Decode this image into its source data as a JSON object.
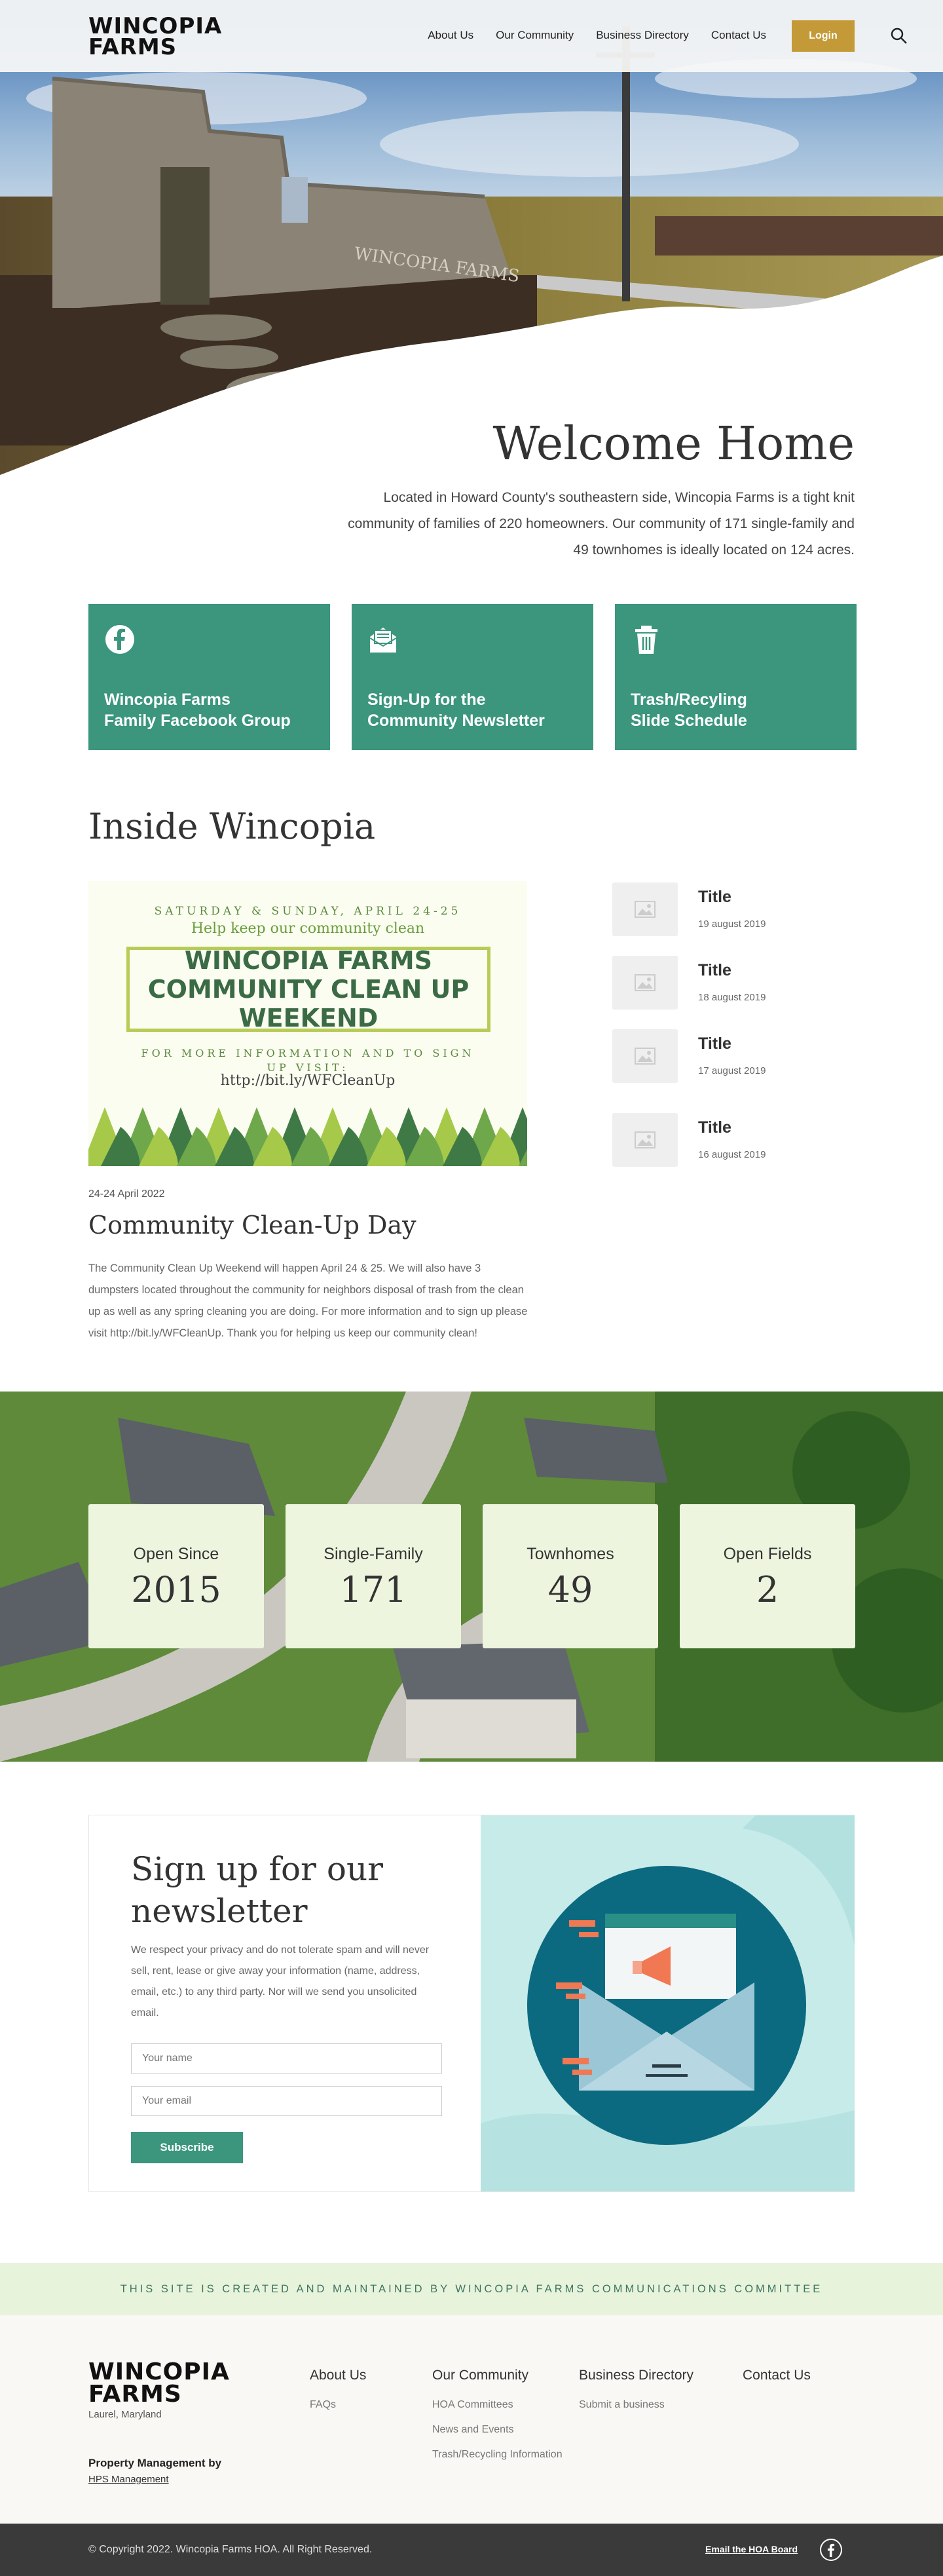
{
  "header": {
    "logo": "WINCOPIA\nFARMS",
    "nav": [
      "About Us",
      "Our Community",
      "Business Directory",
      "Contact Us"
    ],
    "login": "Login",
    "search_icon": "search-icon"
  },
  "welcome": {
    "title": "Welcome Home",
    "text": "Located in Howard County's southeastern side, Wincopia Farms is a tight knit community of families of 220 homeowners. Our community of 171 single-family and 49 townhomes is ideally located on 124 acres."
  },
  "cards": [
    {
      "label": "Wincopia Farms\nFamily Facebook Group",
      "icon": "facebook-icon"
    },
    {
      "label": "Sign-Up for the\nCommunity Newsletter",
      "icon": "envelope-icon"
    },
    {
      "label": "Trash/Recyling\nSlide Schedule",
      "icon": "trash-icon"
    }
  ],
  "inside": {
    "title": "Inside Wincopia",
    "poster": {
      "line1": "SATURDAY & SUNDAY, APRIL 24-25",
      "line2": "Help keep our community clean",
      "headline": "WINCOPIA FARMS COMMUNITY CLEAN UP WEEKEND",
      "line3": "FOR MORE INFORMATION AND TO SIGN UP VISIT:",
      "line4": "http://bit.ly/WFCleanUp"
    },
    "feature": {
      "date": "24-24 April 2022",
      "title": "Community Clean-Up Day",
      "text": "The Community Clean Up Weekend will happen April 24 & 25. We will also have 3 dumpsters located throughout the community for neighbors disposal of trash from the clean up as well as any spring cleaning you are doing. For more information and to sign up please visit http://bit.ly/WFCleanUp. Thank you for helping us keep our community clean!"
    },
    "news": [
      {
        "title": "Title",
        "date": "19 august 2019"
      },
      {
        "title": "Title",
        "date": "18 august 2019"
      },
      {
        "title": "Title",
        "date": "17 august 2019"
      },
      {
        "title": "Title",
        "date": "16 august 2019"
      }
    ]
  },
  "stats": [
    {
      "label": "Open Since",
      "value": "2015"
    },
    {
      "label": "Single-Family",
      "value": "171"
    },
    {
      "label": "Townhomes",
      "value": "49"
    },
    {
      "label": "Open Fields",
      "value": "2"
    }
  ],
  "newsletter": {
    "title": "Sign up for our newsletter",
    "text": "We respect your privacy and do not tolerate spam and will never sell, rent, lease or give away your information (name, address, email, etc.) to any third party. Nor will we send you unsolicited email.",
    "name_placeholder": "Your name",
    "email_placeholder": "Your email",
    "button": "Subscribe"
  },
  "banner": "THIS SITE IS CREATED AND MAINTAINED BY WINCOPIA FARMS COMMUNICATIONS COMMITTEE",
  "footer": {
    "logo": "WINCOPIA\nFARMS",
    "location": "Laurel, Maryland",
    "pm_label": "Property Management by",
    "pm_link": "HPS Management",
    "columns": [
      {
        "title": "About Us",
        "links": [
          "FAQs"
        ]
      },
      {
        "title": "Our Community",
        "links": [
          "HOA Committees",
          "News and Events",
          "Trash/Recycling Information"
        ]
      },
      {
        "title": "Business Directory",
        "links": [
          "Submit a business"
        ]
      },
      {
        "title": "Contact Us",
        "links": []
      }
    ],
    "copyright": "© Copyright 2022. Wincopia Farms HOA. All Right Reserved.",
    "email_board": "Email the HOA Board",
    "social_icon": "facebook-icon"
  },
  "colors": {
    "accent_green": "#3b967d",
    "gold": "#c39a37",
    "light_green": "#eef5df"
  }
}
